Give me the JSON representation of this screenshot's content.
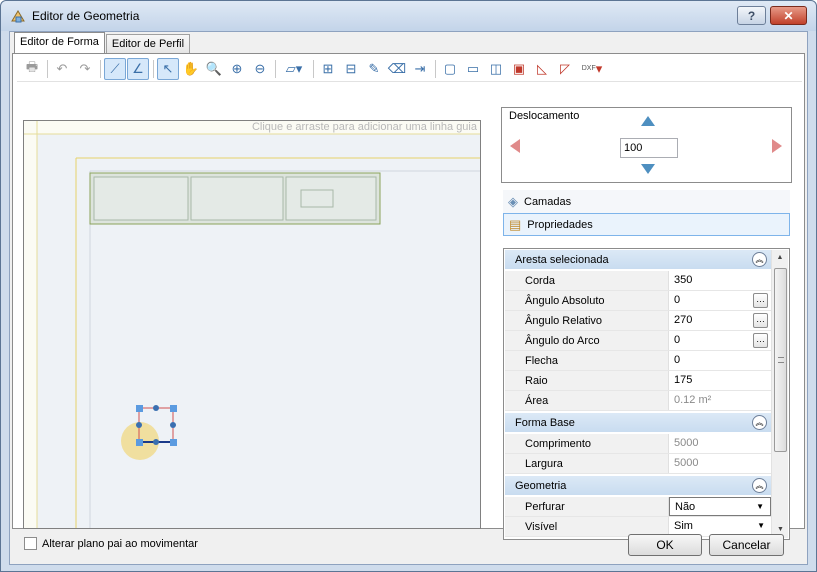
{
  "window": {
    "title": "Editor de Geometria",
    "help_label": "?",
    "close_label": "✕"
  },
  "tabs": [
    {
      "label": "Editor de Forma",
      "active": true
    },
    {
      "label": "Editor de Perfil",
      "active": false
    }
  ],
  "toolbar": {
    "icons": [
      "print-icon",
      "undo-icon",
      "redo-icon",
      "snap-icon",
      "snap-angle-icon",
      "select-icon",
      "pan-icon",
      "zoom-icon",
      "zoom-in-icon",
      "zoom-out-icon",
      "polygon-dropdown-icon",
      "add-vertex-icon",
      "remove-vertex-icon",
      "edit-edge-icon",
      "delete-edge-icon",
      "align-icon",
      "shape1-icon",
      "shape2-icon",
      "shape3-icon",
      "shape4-icon",
      "shape5-icon",
      "shape6-icon",
      "dxf-import-icon"
    ],
    "dxf_label": "DXF"
  },
  "canvas": {
    "guide_hint": "Clique e arraste para adicionar uma linha guia"
  },
  "displacement": {
    "label": "Deslocamento",
    "value": "100"
  },
  "panels": {
    "layers_label": "Camadas",
    "properties_label": "Propriedades"
  },
  "properties": {
    "selected_edge": {
      "title": "Aresta selecionada",
      "rows": [
        {
          "name": "Corda",
          "value": "350"
        },
        {
          "name": "Ângulo Absoluto",
          "value": "0"
        },
        {
          "name": "Ângulo Relativo",
          "value": "270"
        },
        {
          "name": "Ângulo do Arco",
          "value": "0"
        },
        {
          "name": "Flecha",
          "value": "0"
        },
        {
          "name": "Raio",
          "value": "175"
        },
        {
          "name": "Área",
          "value": "0.12 m²"
        }
      ]
    },
    "base_shape": {
      "title": "Forma Base",
      "rows": [
        {
          "name": "Comprimento",
          "value": "5000"
        },
        {
          "name": "Largura",
          "value": "5000"
        }
      ]
    },
    "geometry": {
      "title": "Geometria",
      "rows": [
        {
          "name": "Perfurar",
          "value": "Não"
        },
        {
          "name": "Visível",
          "value": "Sim"
        }
      ]
    }
  },
  "footer": {
    "checkbox_label": "Alterar plano pai ao movimentar",
    "ok_label": "OK",
    "cancel_label": "Cancelar"
  }
}
